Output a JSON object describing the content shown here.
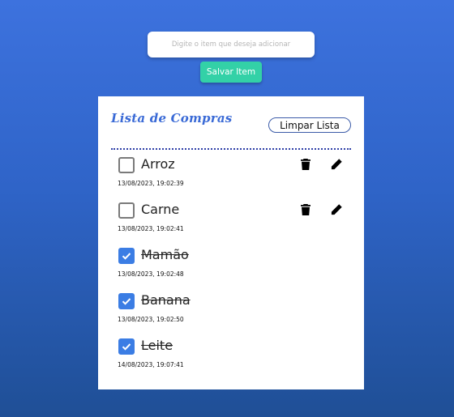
{
  "form": {
    "input_placeholder": "Digite o item que deseja adicionar",
    "input_value": "",
    "save_label": "Salvar Item"
  },
  "list": {
    "title": "Lista de Compras",
    "clear_label": "Limpar Lista",
    "items": [
      {
        "name": "Arroz",
        "timestamp": "13/08/2023, 19:02:39",
        "checked": false
      },
      {
        "name": "Carne",
        "timestamp": "13/08/2023, 19:02:41",
        "checked": false
      },
      {
        "name": "Mamão",
        "timestamp": "13/08/2023, 19:02:48",
        "checked": true
      },
      {
        "name": "Banana",
        "timestamp": "13/08/2023, 19:02:50",
        "checked": true
      },
      {
        "name": "Leite",
        "timestamp": "14/08/2023, 19:07:41",
        "checked": true
      }
    ]
  },
  "icons": {
    "delete": "trash-icon",
    "edit": "pencil-icon",
    "check": "checkmark-icon"
  },
  "colors": {
    "accent_green": "#33d1a7",
    "title_blue": "#3a6ad6",
    "checkbox_blue": "#3b7de4",
    "background_top": "#3d72de",
    "background_bottom": "#1f4f96"
  }
}
